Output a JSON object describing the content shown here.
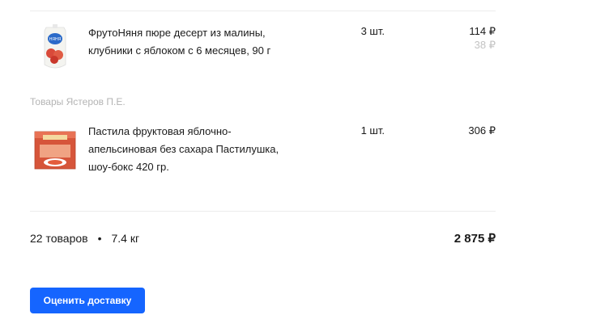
{
  "items": [
    {
      "name": "ФрутоНяня пюре десерт из малины, клубники с яблоком с 6 месяцев, 90 г",
      "qty": "3 шт.",
      "price": "114 ₽",
      "old_price": "38 ₽",
      "image": "puree-pouch-image"
    },
    {
      "name": "Пастила фруктовая яблочно-апельсиновая без сахара Пастилушка, шоу-бокс 420 гр.",
      "qty": "1 шт.",
      "price": "306 ₽",
      "image": "pastila-box-image"
    }
  ],
  "seller": "Товары Ястеров П.Е.",
  "summary": {
    "count": "22 товаров",
    "separator": "•",
    "weight": "7.4 кг",
    "total": "2 875 ₽"
  },
  "button_label": "Оценить доставку",
  "colors": {
    "accent": "#1565ff",
    "muted": "#b4b4b4"
  }
}
